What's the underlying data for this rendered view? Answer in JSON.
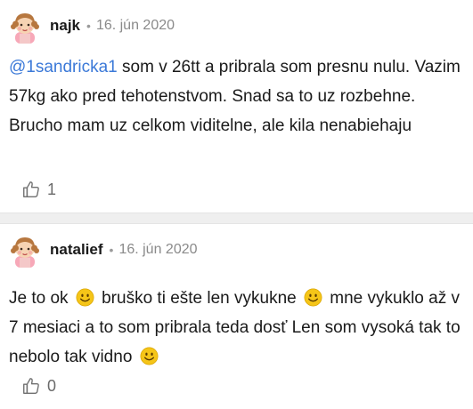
{
  "posts": [
    {
      "author": "najk",
      "separator": "•",
      "date": "16. jún 2020",
      "mention": "@1sandricka1",
      "text": " som v 26tt a pribrala som presnu nulu. Vazim 57kg ako pred tehotenstvom. Snad sa to uz rozbehne. Brucho mam uz celkom viditelne, ale kila nenabiehaju",
      "likes": "1"
    },
    {
      "author": "natalief",
      "separator": "•",
      "date": "16. jún 2020",
      "text_1": "Je to ok ",
      "text_2": " bruško ti ešte len vykukne ",
      "text_3": " mne vykuklo až v 7 mesiaci a to som pribrala teda dosť Len som vysoká tak to nebolo tak vidno ",
      "likes": "0"
    }
  ],
  "icons": {
    "avatar": "girl-avatar-icon",
    "like": "thumbs-up-icon",
    "emoji": "smiley-icon"
  },
  "colors": {
    "mention": "#3b79d8",
    "emoji": "#f5c518",
    "divider": "#efefef"
  }
}
